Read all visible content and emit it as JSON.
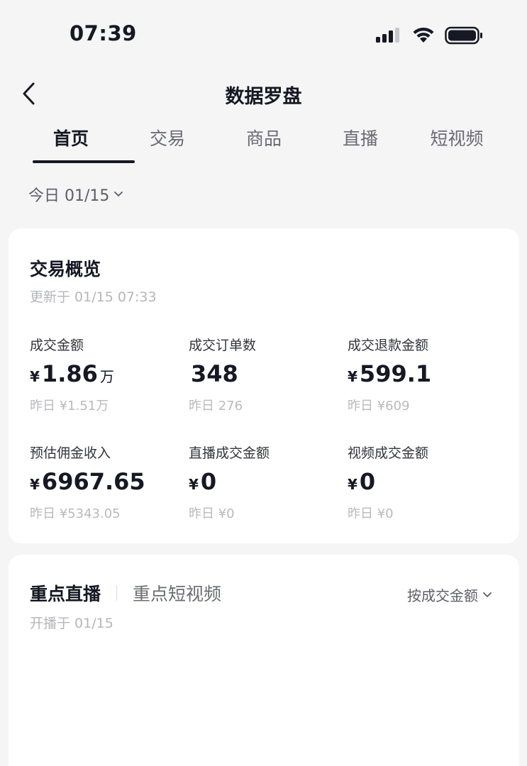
{
  "status_bar": {
    "time": "07:39"
  },
  "nav": {
    "title": "数据罗盘"
  },
  "tabs": [
    {
      "label": "首页",
      "active": true
    },
    {
      "label": "交易",
      "active": false
    },
    {
      "label": "商品",
      "active": false
    },
    {
      "label": "直播",
      "active": false
    },
    {
      "label": "短视频",
      "active": false
    }
  ],
  "date_selector": {
    "label": "今日 01/15"
  },
  "trade_overview": {
    "title": "交易概览",
    "updated": "更新于 01/15 07:33",
    "metrics": [
      {
        "label": "成交金额",
        "currency": "¥",
        "value": "1.86",
        "unit": "万",
        "yesterday": "昨日 ¥1.51万"
      },
      {
        "label": "成交订单数",
        "currency": "",
        "value": "348",
        "unit": "",
        "yesterday": "昨日 276"
      },
      {
        "label": "成交退款金额",
        "currency": "¥",
        "value": "599.1",
        "unit": "",
        "yesterday": "昨日 ¥609"
      },
      {
        "label": "预估佣金收入",
        "currency": "¥",
        "value": "6967.65",
        "unit": "",
        "yesterday": "昨日 ¥5343.05"
      },
      {
        "label": "直播成交金额",
        "currency": "¥",
        "value": "0",
        "unit": "",
        "yesterday": "昨日 ¥0"
      },
      {
        "label": "视频成交金额",
        "currency": "¥",
        "value": "0",
        "unit": "",
        "yesterday": "昨日 ¥0"
      }
    ]
  },
  "focus": {
    "tab_live": "重点直播",
    "tab_video": "重点短视频",
    "sort_label": "按成交金额",
    "started": "开播于 01/15"
  },
  "colors": {
    "text": "#161823",
    "muted": "#b5b6ba",
    "background": "#f5f5f6"
  }
}
